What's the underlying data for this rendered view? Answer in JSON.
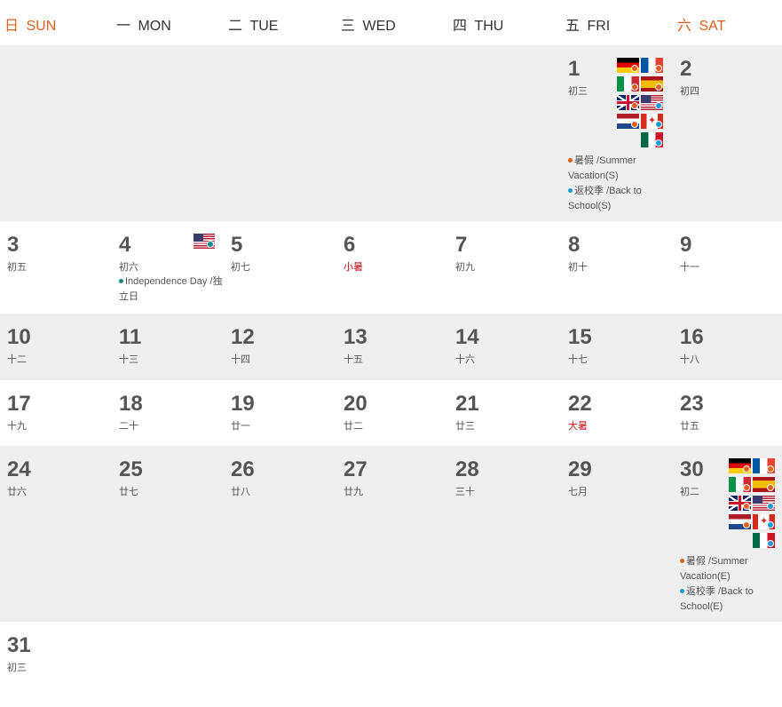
{
  "weekdays": [
    {
      "cn": "日",
      "en": "SUN",
      "weekend": true
    },
    {
      "cn": "一",
      "en": "MON",
      "weekend": false
    },
    {
      "cn": "二",
      "en": "TUE",
      "weekend": false
    },
    {
      "cn": "三",
      "en": "WED",
      "weekend": false
    },
    {
      "cn": "四",
      "en": "THU",
      "weekend": false
    },
    {
      "cn": "五",
      "en": "FRI",
      "weekend": false
    },
    {
      "cn": "六",
      "en": "SAT",
      "weekend": true
    }
  ],
  "colors": {
    "weekend": "#e0611d",
    "solar_term": "#c8161d",
    "summer_dot": "#e0611d",
    "school_dot": "#1c9ad6",
    "holiday_dot": "#12898a",
    "shade": "#efefef"
  },
  "weeks": [
    {
      "days": [
        null,
        null,
        null,
        null,
        null,
        {
          "num": "1",
          "lunar": "初三",
          "flags": [
            "de",
            "fr",
            "it",
            "es",
            "gb",
            "us",
            "nl",
            "ca",
            "mx"
          ],
          "events": [
            {
              "dot": "summer",
              "text": "暑假 /Summer Vacation(S)"
            },
            {
              "dot": "school",
              "text": "返校季 /Back to School(S)"
            }
          ]
        },
        {
          "num": "2",
          "lunar": "初四"
        }
      ]
    },
    {
      "days": [
        {
          "num": "3",
          "lunar": "初五"
        },
        {
          "num": "4",
          "lunar": "初六",
          "flags": [
            "us-holiday"
          ],
          "events": [
            {
              "dot": "holiday",
              "text": "Independence Day /独立日"
            }
          ]
        },
        {
          "num": "5",
          "lunar": "初七"
        },
        {
          "num": "6",
          "lunar": "小暑",
          "term": true
        },
        {
          "num": "7",
          "lunar": "初九"
        },
        {
          "num": "8",
          "lunar": "初十"
        },
        {
          "num": "9",
          "lunar": "十一"
        }
      ]
    },
    {
      "days": [
        {
          "num": "10",
          "lunar": "十二"
        },
        {
          "num": "11",
          "lunar": "十三"
        },
        {
          "num": "12",
          "lunar": "十四"
        },
        {
          "num": "13",
          "lunar": "十五"
        },
        {
          "num": "14",
          "lunar": "十六"
        },
        {
          "num": "15",
          "lunar": "十七"
        },
        {
          "num": "16",
          "lunar": "十八"
        }
      ]
    },
    {
      "days": [
        {
          "num": "17",
          "lunar": "十九"
        },
        {
          "num": "18",
          "lunar": "二十"
        },
        {
          "num": "19",
          "lunar": "廿一"
        },
        {
          "num": "20",
          "lunar": "廿二"
        },
        {
          "num": "21",
          "lunar": "廿三"
        },
        {
          "num": "22",
          "lunar": "大暑",
          "term": true
        },
        {
          "num": "23",
          "lunar": "廿五"
        }
      ]
    },
    {
      "days": [
        {
          "num": "24",
          "lunar": "廿六"
        },
        {
          "num": "25",
          "lunar": "廿七"
        },
        {
          "num": "26",
          "lunar": "廿八"
        },
        {
          "num": "27",
          "lunar": "廿九"
        },
        {
          "num": "28",
          "lunar": "三十"
        },
        {
          "num": "29",
          "lunar": "七月"
        },
        {
          "num": "30",
          "lunar": "初二",
          "flags": [
            "de",
            "fr",
            "it",
            "es",
            "gb",
            "us",
            "nl",
            "ca",
            "mx"
          ],
          "events": [
            {
              "dot": "summer",
              "text": "暑假 /Summer Vacation(E)"
            },
            {
              "dot": "school",
              "text": "返校季 /Back to School(E)"
            }
          ]
        }
      ]
    },
    {
      "days": [
        {
          "num": "31",
          "lunar": "初三"
        },
        null,
        null,
        null,
        null,
        null,
        null
      ]
    }
  ]
}
